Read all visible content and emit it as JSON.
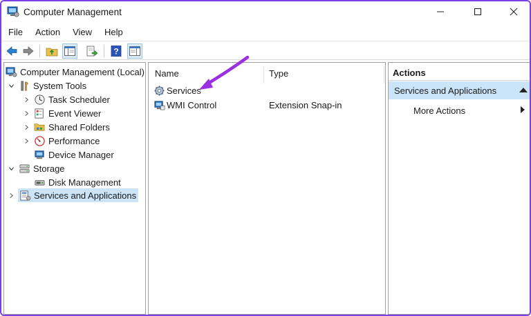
{
  "window": {
    "title": "Computer Management",
    "icon": "computer-management-icon"
  },
  "menu": [
    "File",
    "Action",
    "View",
    "Help"
  ],
  "toolbar": {
    "buttons": [
      "back-arrow-icon",
      "forward-arrow-icon",
      "up-folder-icon",
      "show-hide-console-tree-icon",
      "export-list-icon",
      "help-icon",
      "show-hide-action-pane-icon"
    ]
  },
  "tree": {
    "root": "Computer Management (Local)",
    "system_tools": "System Tools",
    "task_scheduler": "Task Scheduler",
    "event_viewer": "Event Viewer",
    "shared_folders": "Shared Folders",
    "performance": "Performance",
    "device_manager": "Device Manager",
    "storage": "Storage",
    "disk_management": "Disk Management",
    "services_apps": "Services and Applications"
  },
  "list": {
    "columns": [
      "Name",
      "Type"
    ],
    "rows": [
      {
        "name": "Services",
        "type": ""
      },
      {
        "name": "WMI Control",
        "type": "Extension Snap-in"
      }
    ]
  },
  "actions": {
    "header": "Actions",
    "section": "Services and Applications",
    "item": "More Actions"
  },
  "colors": {
    "accent_frame": "#7b3fe4",
    "selection": "#cce4f7",
    "annotation_arrow": "#9b30e0"
  }
}
